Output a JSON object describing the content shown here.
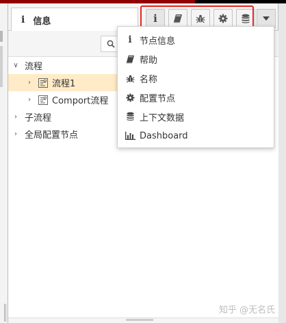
{
  "header": {
    "tab_title": "信息",
    "buttons": [
      {
        "icon": "info-icon"
      },
      {
        "icon": "book-icon"
      },
      {
        "icon": "bug-icon"
      },
      {
        "icon": "gear-icon"
      },
      {
        "icon": "database-icon"
      }
    ],
    "dropdown_icon": "caret-down-icon",
    "highlight_color": "#e8231d"
  },
  "toolbar": {
    "search_icon": "search-icon"
  },
  "tree": {
    "flows": {
      "label": "流程",
      "expanded": true
    },
    "flow_items": [
      {
        "label": "流程1",
        "selected": true
      },
      {
        "label": "Comport流程",
        "selected": false
      }
    ],
    "subflows": {
      "label": "子流程",
      "expanded": false
    },
    "global_config": {
      "label": "全局配置节点",
      "expanded": false
    }
  },
  "menu": {
    "items": [
      {
        "label": "节点信息",
        "icon": "info-icon"
      },
      {
        "label": "帮助",
        "icon": "book-icon"
      },
      {
        "label": "名称",
        "icon": "bug-icon"
      },
      {
        "label": "配置节点",
        "icon": "gear-icon"
      },
      {
        "label": "上下文数据",
        "icon": "database-icon"
      },
      {
        "label": "Dashboard",
        "icon": "bar-chart-icon"
      }
    ]
  },
  "watermark": "知乎 @无名氏",
  "colors": {
    "selected_row": "#ffebc7",
    "panel_bg": "#f5f5f5"
  }
}
